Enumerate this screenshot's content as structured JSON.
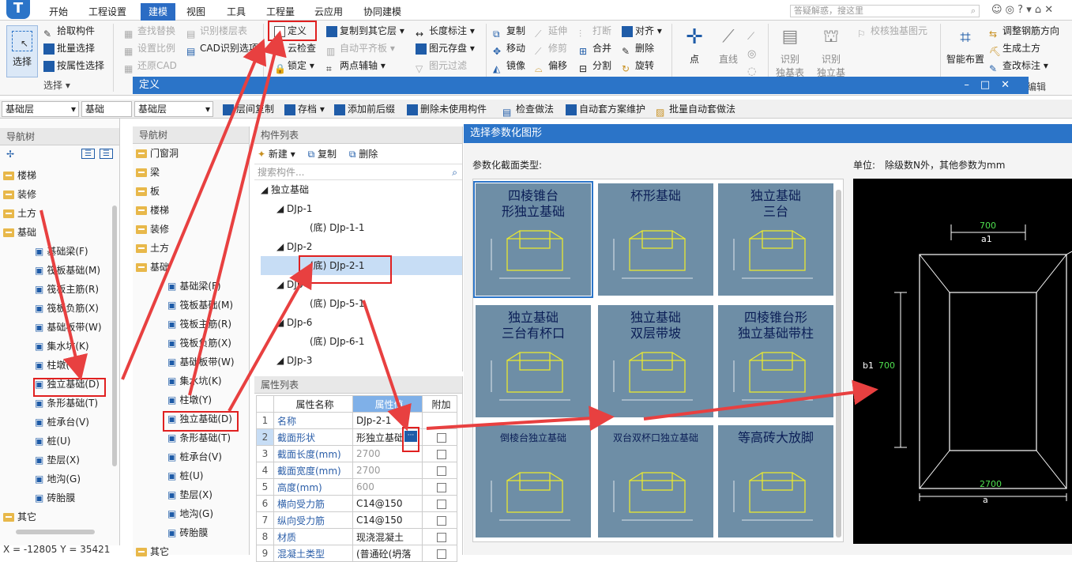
{
  "menubar": {
    "tabs": [
      "开始",
      "工程设置",
      "建模",
      "视图",
      "工具",
      "工程量",
      "云应用",
      "协同建模"
    ],
    "active": "建模",
    "search_placeholder": "答疑解惑，搜这里"
  },
  "ribbon": {
    "select_group": {
      "big": "选择",
      "items": [
        "拾取构件",
        "批量选择",
        "按属性选择"
      ],
      "group_label": "选择 ▾"
    },
    "col2": [
      "查找替换",
      "设置比例",
      "还原CAD"
    ],
    "col3": [
      "识别楼层表",
      "CAD识别选项"
    ],
    "col4": [
      "定义",
      "云检查",
      "锁定 ▾"
    ],
    "col5": [
      "复制到其它层 ▾",
      "自动平齐板 ▾",
      "两点辅轴 ▾"
    ],
    "col6": [
      "长度标注 ▾",
      "图元存盘 ▾",
      "图元过滤"
    ],
    "col7": [
      "复制",
      "移动",
      "镜像"
    ],
    "col8": [
      "延伸",
      "修剪",
      "偏移"
    ],
    "col9": [
      "打断",
      "合并",
      "分割"
    ],
    "col10": [
      "对齐 ▾",
      "删除",
      "旋转"
    ],
    "draw": [
      "点",
      "直线"
    ],
    "recog": [
      "识别",
      "识别",
      "校核独基图元"
    ],
    "recog_sub": [
      "独基表",
      "独立基础"
    ],
    "right_big": "智能布置",
    "right": [
      "调整钢筋方向",
      "生成土方",
      "查改标注 ▾"
    ],
    "edit": "编辑"
  },
  "def_window": {
    "title": "定义"
  },
  "toolbar": {
    "combo1": "基础层",
    "combo2": "基础",
    "combo3": "基础层",
    "btns": [
      "层间复制",
      "存档 ▾",
      "添加前后缀",
      "删除未使用构件",
      "检查做法",
      "自动套方案维护",
      "批量自动套做法"
    ]
  },
  "nav_left": {
    "title": "导航树",
    "items": [
      "楼梯",
      "装修",
      "土方",
      "基础"
    ],
    "sub": [
      "基础梁(F)",
      "筏板基础(M)",
      "筏板主筋(R)",
      "筏板负筋(X)",
      "基础板带(W)",
      "集水坑(K)",
      "柱墩(Y)",
      "独立基础(D)",
      "条形基础(T)",
      "桩承台(V)",
      "桩(U)",
      "垫层(X)",
      "地沟(G)",
      "砖胎膜"
    ],
    "other": "其它",
    "coords": "X = -12805 Y = 35421"
  },
  "nav_mid": {
    "title": "导航树",
    "items": [
      "门窗洞",
      "梁",
      "板",
      "楼梯",
      "装修",
      "土方",
      "基础"
    ],
    "sub": [
      "基础梁(F)",
      "筏板基础(M)",
      "筏板主筋(R)",
      "筏板负筋(X)",
      "基础板带(W)",
      "集水坑(K)",
      "柱墩(Y)",
      "独立基础(D)",
      "条形基础(T)",
      "桩承台(V)",
      "桩(U)",
      "垫层(X)",
      "地沟(G)",
      "砖胎膜"
    ],
    "other": "其它"
  },
  "comp_list": {
    "title": "构件列表",
    "btns": [
      "新建 ▾",
      "复制",
      "删除"
    ],
    "search_placeholder": "搜索构件...",
    "root": "独立基础",
    "items": [
      {
        "name": "DJp-1",
        "child": "(底) DJp-1-1"
      },
      {
        "name": "DJp-2",
        "child": "(底) DJp-2-1"
      },
      {
        "name": "DJp-5",
        "child": "(底) DJp-5-1"
      },
      {
        "name": "DJp-6",
        "child": "(底) DJp-6-1"
      },
      {
        "name": "DJp-3",
        "child": ""
      }
    ]
  },
  "props": {
    "title": "属性列表",
    "headers": [
      "属性名称",
      "属性值",
      "附加"
    ],
    "rows": [
      [
        "1",
        "名称",
        "DJp-2-1"
      ],
      [
        "2",
        "截面形状",
        "形独立基础"
      ],
      [
        "3",
        "截面长度(mm)",
        "2700"
      ],
      [
        "4",
        "截面宽度(mm)",
        "2700"
      ],
      [
        "5",
        "高度(mm)",
        "600"
      ],
      [
        "6",
        "横向受力筋",
        "C14@150"
      ],
      [
        "7",
        "纵向受力筋",
        "C14@150"
      ],
      [
        "8",
        "材质",
        "现浇混凝土"
      ],
      [
        "9",
        "混凝土类型",
        "(普通砼(坍落"
      ]
    ]
  },
  "param": {
    "title": "选择参数化图形",
    "section": "参数化截面类型:",
    "unit": "单位:　除级数N外，其他参数为mm",
    "tiles": [
      "四棱锥台\n形独立基础",
      "杯形基础",
      "独立基础\n三台",
      "独立基础\n三台有杯口",
      "独立基础\n双层带坡",
      "四棱锥台形\n独立基础带柱",
      "倒棱台独立基础",
      "双台双杯口独立基础",
      "等高砖大放脚"
    ],
    "preview": {
      "top_val": "700",
      "top_lbl": "a1",
      "left_lbl": "b1",
      "left_val": "700",
      "bot_val": "2700",
      "bot_lbl": "a"
    }
  },
  "colors": {
    "accent": "#2b74c8",
    "red": "#e02020",
    "tile_bg": "#6e8ea6"
  }
}
